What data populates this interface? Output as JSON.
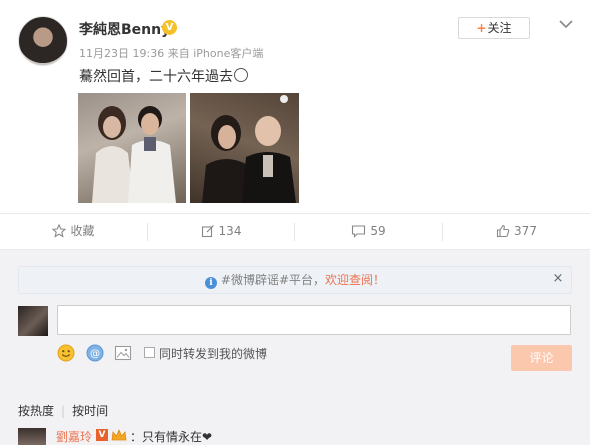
{
  "post": {
    "username": "李純恩Benny",
    "verified_badge": "V",
    "time": "11月23日 19:36",
    "source_prefix": "来自",
    "source": "iPhone客户端",
    "text": "驀然回首，二十六年過去",
    "follow_label": "关注",
    "follow_plus": "+"
  },
  "actions": {
    "favorite_label": "收藏",
    "repost_count": "134",
    "comment_count": "59",
    "like_count": "377"
  },
  "comment_box": {
    "notice_prefix": "#微博辟谣#平台，",
    "notice_link": "欢迎查阅！",
    "notice_icon": "i",
    "close_symbol": "×",
    "input_value": "",
    "repost_checkbox_label": "同时转发到我的微博",
    "submit_label": "评论"
  },
  "sort": {
    "by_hot": "按热度",
    "divider": "|",
    "by_time": "按时间"
  },
  "first_comment": {
    "name": "劉嘉玲",
    "badge": "V",
    "text": "：只有情永在❤"
  },
  "colors": {
    "accent_orange": "#eb7350",
    "submit_disabled": "#fbc8ae",
    "verified_gold": "#f6c12b"
  }
}
